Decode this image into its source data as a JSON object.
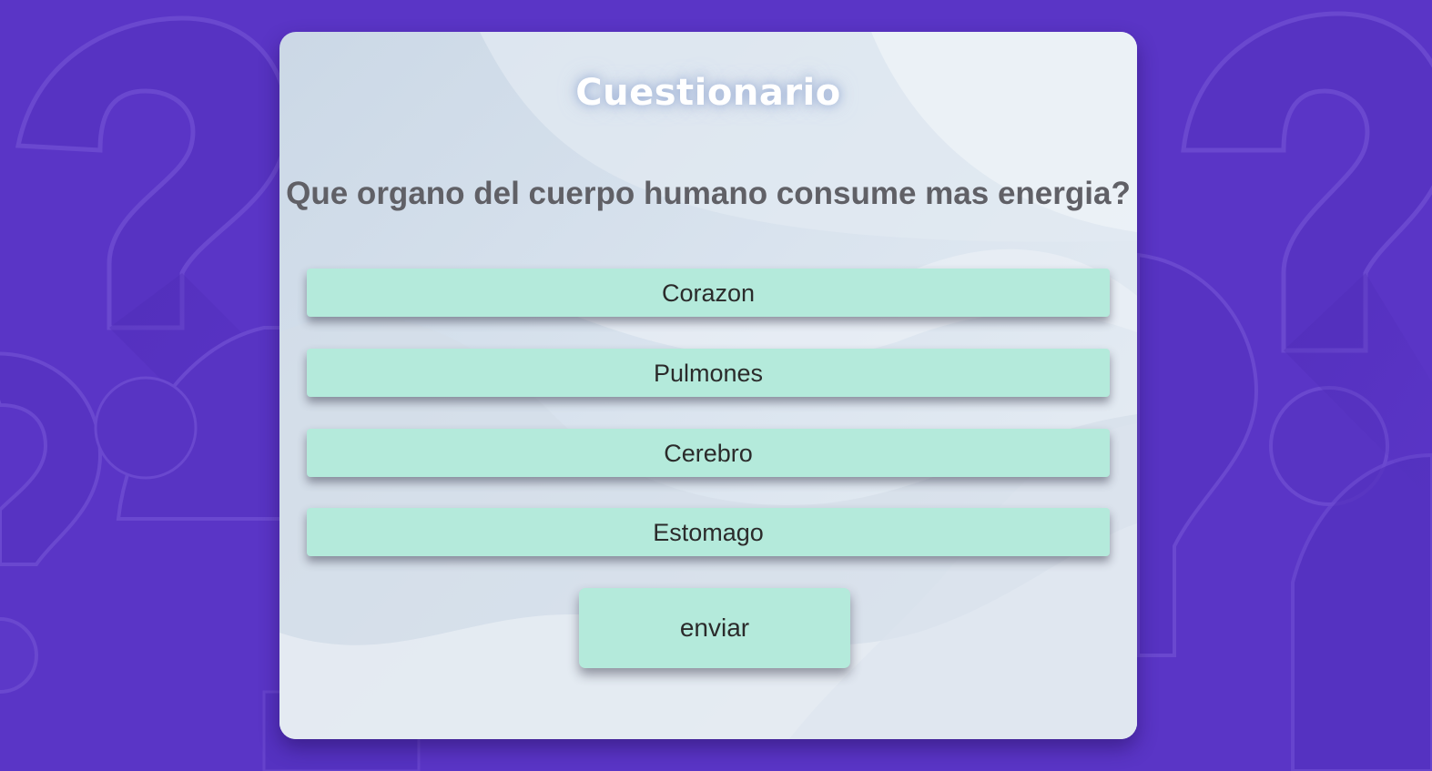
{
  "quiz": {
    "title": "Cuestionario",
    "question": "Que organo del cuerpo humano consume mas energia?",
    "options": [
      {
        "label": "Corazon"
      },
      {
        "label": "Pulmones"
      },
      {
        "label": "Cerebro"
      },
      {
        "label": "Estomago"
      }
    ],
    "submit_label": "enviar"
  },
  "colors": {
    "background": "#5a35c6",
    "option_fill": "#b4eadb",
    "question_text": "#606066",
    "title_text": "#ffffff"
  },
  "icons": {
    "background_pattern": "question-mark-icon"
  }
}
